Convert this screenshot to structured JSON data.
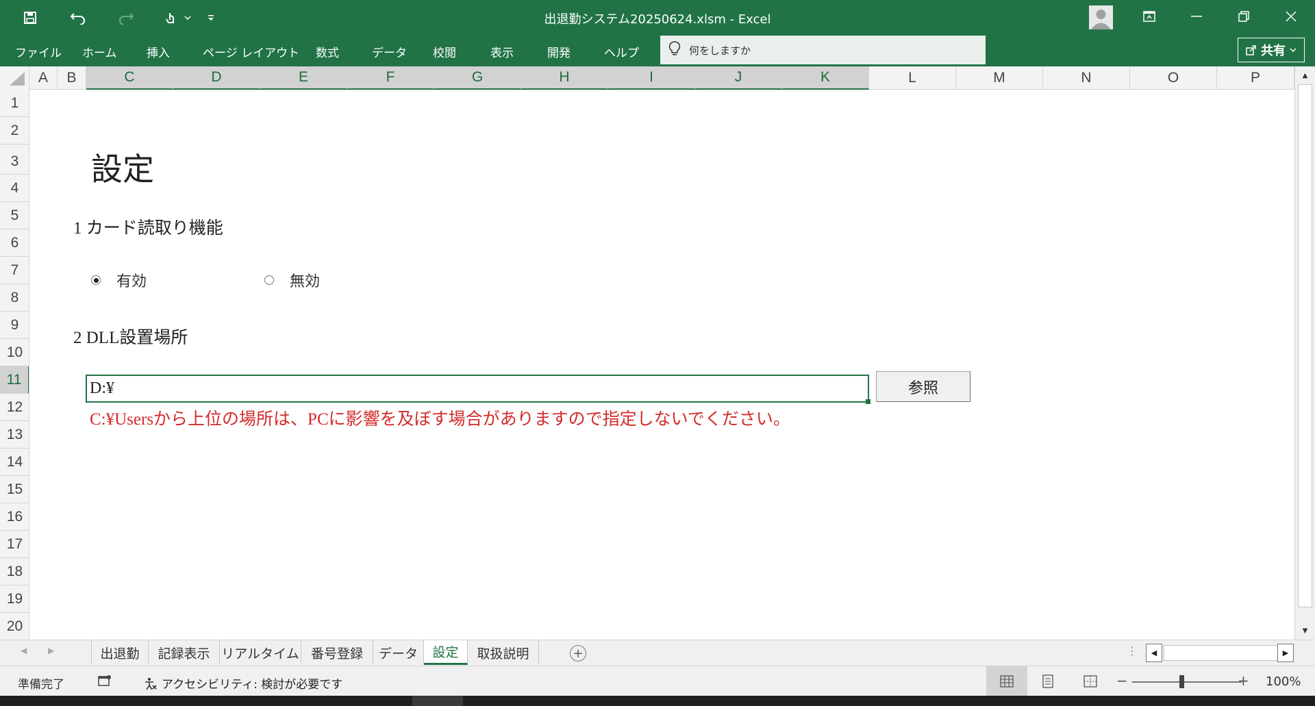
{
  "window": {
    "title": "出退勤システム20250624.xlsm  -  Excel"
  },
  "ribbon": {
    "tabs": [
      "ファイル",
      "ホーム",
      "挿入",
      "ページ レイアウト",
      "数式",
      "データ",
      "校閲",
      "表示",
      "開発",
      "ヘルプ"
    ],
    "tellme_label": "何をしますか",
    "share_label": "共有"
  },
  "grid": {
    "columns": [
      "A",
      "B",
      "C",
      "D",
      "E",
      "F",
      "G",
      "H",
      "I",
      "J",
      "K",
      "L",
      "M",
      "N",
      "O",
      "P"
    ],
    "rows": [
      "1",
      "2",
      "3",
      "4",
      "5",
      "6",
      "7",
      "8",
      "9",
      "10",
      "11",
      "12",
      "13",
      "14",
      "15",
      "16",
      "17",
      "18",
      "19",
      "20"
    ],
    "selected_columns": [
      "C",
      "D",
      "E",
      "F",
      "G",
      "H",
      "I",
      "J",
      "K"
    ],
    "selected_row": "11"
  },
  "sheet": {
    "heading": "設定",
    "section1": "1 カード読取り機能",
    "radio_enabled": "有効",
    "radio_disabled": "無効",
    "card_reader_state": "有効",
    "section2": "2 DLL設置場所",
    "dll_path": "D:¥",
    "browse_label": "参照",
    "warning": "C:¥Usersから上位の場所は、PCに影響を及ぼす場合がありますので指定しないでください。"
  },
  "sheet_tabs": {
    "tabs": [
      "出退勤",
      "記録表示",
      "リアルタイム",
      "番号登録",
      "データ",
      "設定",
      "取扱説明"
    ],
    "active": "設定"
  },
  "statusbar": {
    "ready": "準備完了",
    "accessibility": "アクセシビリティ: 検討が必要です",
    "zoom": "100%"
  },
  "colors": {
    "accent": "#217346",
    "warning_text": "#d42b2b"
  }
}
